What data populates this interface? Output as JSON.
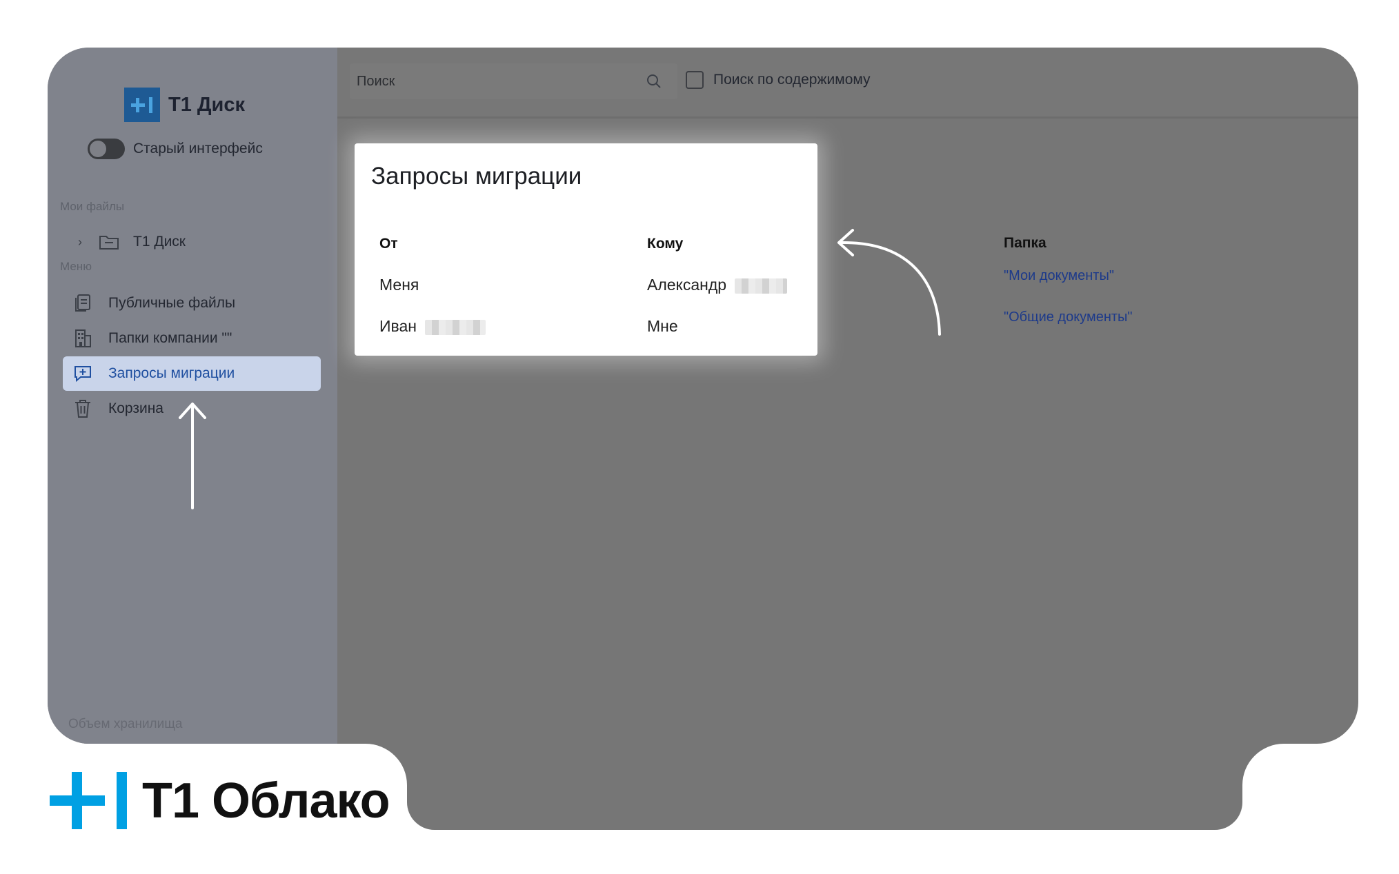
{
  "app": {
    "logo_text": "Т1 Диск",
    "old_ui_toggle_label": "Старый интерфейс"
  },
  "sidebar": {
    "my_files_label": "Мои файлы",
    "tree_item": "Т1 Диск",
    "menu_label": "Меню",
    "items": [
      {
        "label": "Публичные файлы",
        "icon": "public-files-icon"
      },
      {
        "label": "Папки компании \"\"",
        "icon": "building-icon"
      },
      {
        "label": "Запросы миграции",
        "icon": "migration-request-icon",
        "active": true
      },
      {
        "label": "Корзина",
        "icon": "trash-icon"
      }
    ],
    "storage_label": "Объем хранилища"
  },
  "topbar": {
    "search_placeholder": "Поиск",
    "content_search_label": "Поиск по содержимому"
  },
  "background_table": {
    "folder_header": "Папка",
    "folders": [
      "\"Мои документы\"",
      "\"Общие документы\""
    ]
  },
  "dialog": {
    "title": "Запросы миграции",
    "headers": {
      "from": "От",
      "to": "Кому"
    },
    "rows": [
      {
        "from": "Меня",
        "to": "Александр"
      },
      {
        "from": "Иван",
        "to": "Мне"
      }
    ]
  },
  "brand": {
    "text": "Т1 Облако"
  },
  "colors": {
    "overlay": "#767676",
    "active_item_bg": "#c9d4ea",
    "active_item_text": "#1f4fa0",
    "link": "#1d3a8a",
    "brand_blue": "#00a0e3"
  }
}
